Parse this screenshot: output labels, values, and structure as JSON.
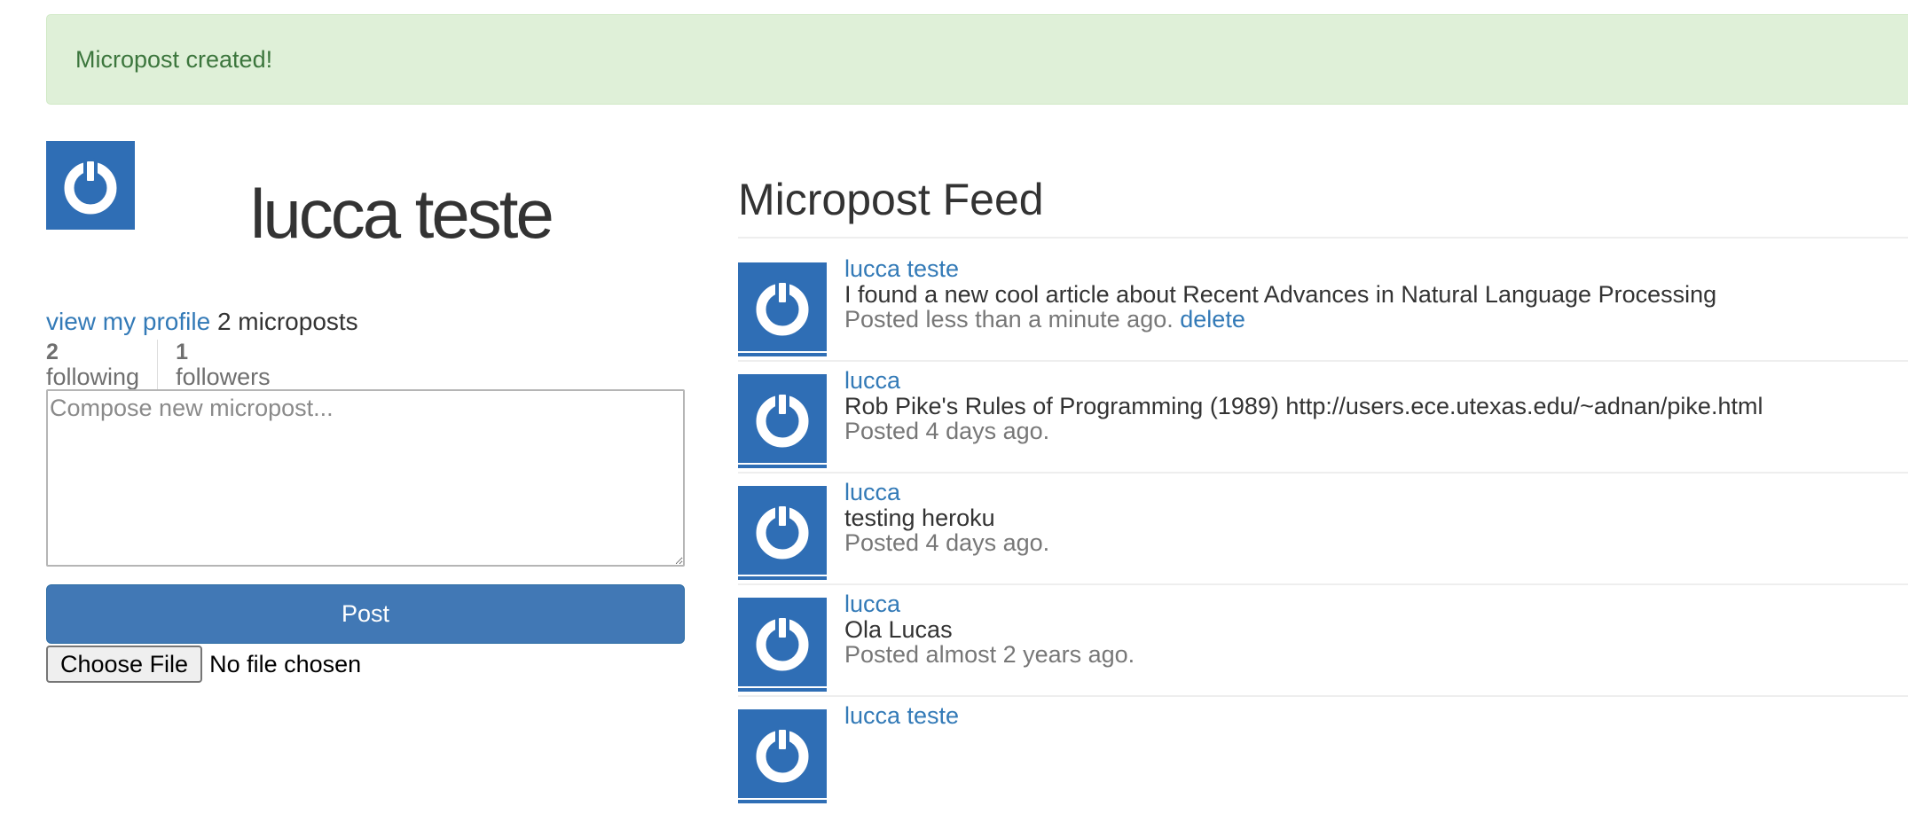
{
  "flash": {
    "message": "Micropost created!"
  },
  "user": {
    "name": "lucca teste",
    "view_profile_label": "view my profile",
    "micropost_count": "2 microposts"
  },
  "stats": {
    "following_count": "2",
    "following_label": "following",
    "followers_count": "1",
    "followers_label": "followers"
  },
  "compose": {
    "placeholder": "Compose new micropost...",
    "post_label": "Post",
    "choose_file_label": "Choose File",
    "file_status": "No file chosen"
  },
  "feed": {
    "title": "Micropost Feed",
    "items": [
      {
        "author": "lucca teste",
        "content": "I found a new cool article about Recent Advances in Natural Language Processing",
        "timestamp": "Posted less than a minute ago.",
        "delete_label": "delete"
      },
      {
        "author": "lucca",
        "content": "Rob Pike's Rules of Programming (1989) http://users.ece.utexas.edu/~adnan/pike.html",
        "timestamp": "Posted 4 days ago."
      },
      {
        "author": "lucca",
        "content": "testing heroku",
        "timestamp": "Posted 4 days ago."
      },
      {
        "author": "lucca",
        "content": "Ola Lucas",
        "timestamp": "Posted almost 2 years ago."
      },
      {
        "author": "lucca teste",
        "content": "",
        "timestamp": ""
      }
    ]
  },
  "colors": {
    "link": "#337ab7",
    "flash_bg": "#dff0d8",
    "flash_text": "#3c763d",
    "button_bg": "#4178b5",
    "gravatar_bg": "#2f6eb5"
  }
}
